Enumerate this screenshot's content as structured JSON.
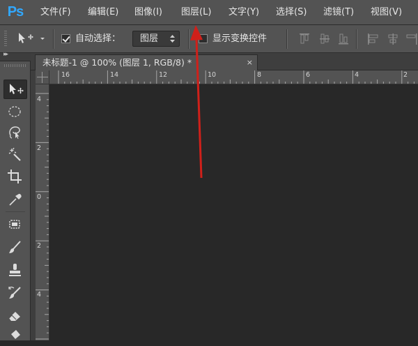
{
  "app": {
    "logo": "Ps"
  },
  "menu": {
    "items": [
      {
        "label": "文件(F)",
        "name": "menu-file"
      },
      {
        "label": "编辑(E)",
        "name": "menu-edit"
      },
      {
        "label": "图像(I)",
        "name": "menu-image"
      },
      {
        "label": "图层(L)",
        "name": "menu-layer"
      },
      {
        "label": "文字(Y)",
        "name": "menu-type"
      },
      {
        "label": "选择(S)",
        "name": "menu-select"
      },
      {
        "label": "滤镜(T)",
        "name": "menu-filter"
      },
      {
        "label": "视图(V)",
        "name": "menu-view"
      }
    ]
  },
  "options": {
    "auto_select_label": "自动选择：",
    "auto_select_checked": true,
    "auto_select_target": "图层",
    "show_transform_label": "显示变换控件",
    "show_transform_checked": false
  },
  "document": {
    "tab_title": "未标题-1 @ 100% (图层 1, RGB/8) *",
    "close_glyph": "×"
  },
  "rulers": {
    "horizontal_labels": [
      "16",
      "14",
      "12",
      "10",
      "8",
      "6",
      "4",
      "2"
    ],
    "vertical_labels": [
      "4",
      "2",
      "0",
      "2",
      "4"
    ]
  },
  "tools": [
    {
      "name": "move-tool-icon",
      "active": true
    },
    {
      "name": "elliptical-marquee-tool-icon",
      "active": false
    },
    {
      "name": "lasso-tool-icon",
      "active": false
    },
    {
      "name": "magic-wand-tool-icon",
      "active": false
    },
    {
      "name": "crop-tool-icon",
      "active": false
    },
    {
      "name": "eyedropper-tool-icon",
      "active": false
    },
    {
      "name": "spot-healing-tool-icon",
      "active": false
    },
    {
      "name": "brush-tool-icon",
      "active": false
    },
    {
      "name": "clone-stamp-tool-icon",
      "active": false
    },
    {
      "name": "history-brush-tool-icon",
      "active": false
    },
    {
      "name": "eraser-tool-icon",
      "active": false
    },
    {
      "name": "paint-bucket-tool-icon",
      "active": false
    }
  ],
  "colors": {
    "logo": "#31a8ff",
    "annotation_arrow": "#d0201a",
    "panel": "#535353",
    "canvas_bg": "#282828"
  }
}
